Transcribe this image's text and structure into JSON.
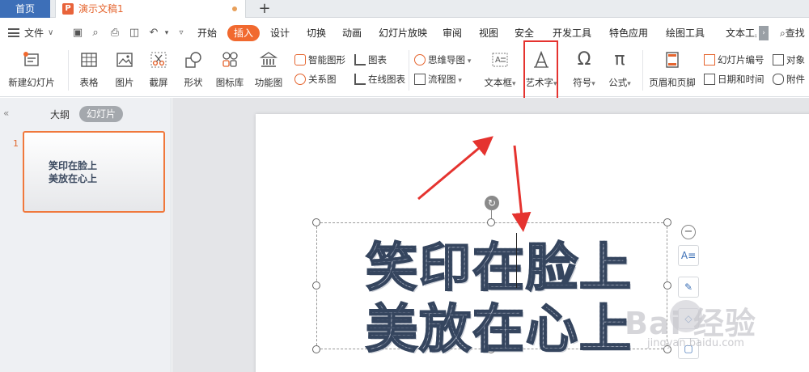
{
  "titlebar": {
    "home_tab": "首页",
    "doc_icon_letter": "P",
    "doc_title": "演示文稿1",
    "add_tab": "+"
  },
  "menubar": {
    "file": "文件",
    "file_arrow": "∨",
    "tabs": [
      "开始",
      "插入",
      "设计",
      "切换",
      "动画",
      "幻灯片放映",
      "审阅",
      "视图",
      "安全",
      "开发工具",
      "特色应用",
      "绘图工具",
      "文本工具"
    ],
    "active_tab": "插入",
    "search": "查找"
  },
  "ribbon": {
    "new_slide": "新建幻灯片",
    "table": "表格",
    "picture": "图片",
    "screenshot": "截屏",
    "shape": "形状",
    "icon_lib": "图标库",
    "function_chart": "功能图",
    "smart_graphic": "智能图形",
    "chart": "图表",
    "relation_chart": "关系图",
    "online_chart": "在线图表",
    "mind_map": "思维导图",
    "flowchart": "流程图",
    "textbox": "文本框",
    "art_text": "艺术字",
    "symbol": "符号",
    "formula": "公式",
    "header_footer": "页眉和页脚",
    "slide_number": "幻灯片编号",
    "object": "对象",
    "date_time": "日期和时间",
    "attachment": "附件"
  },
  "leftpanel": {
    "outline_tab": "大纲",
    "slides_tab": "幻灯片",
    "slide_number": "1",
    "thumb_line1": "笑印在脸上",
    "thumb_line2": "美放在心上"
  },
  "slide": {
    "line1": "笑印在脸上",
    "line2": "美放在心上"
  },
  "watermark": {
    "brand": "Bai 经验",
    "url": "jingyan.baidu.com"
  },
  "colors": {
    "accent_orange": "#f1692f",
    "home_tab_blue": "#3d6fb8",
    "highlight_red": "#e5332f",
    "art_text_stroke": "#35455e"
  }
}
